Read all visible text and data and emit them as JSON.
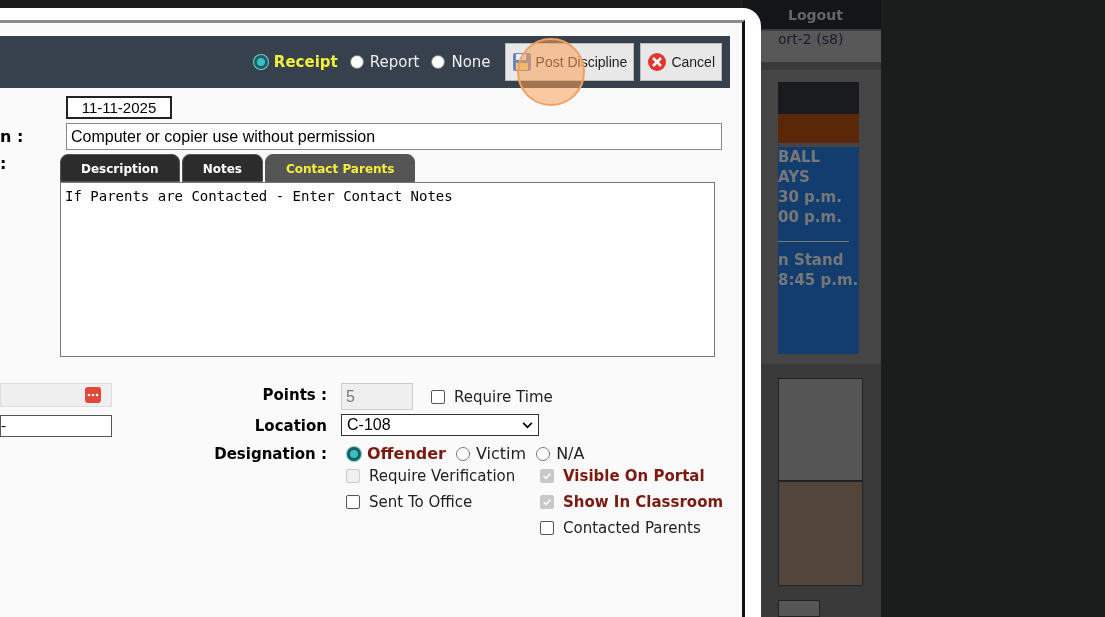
{
  "dialog": {
    "print_options": [
      {
        "label": "Receipt",
        "selected": true
      },
      {
        "label": "Report",
        "selected": false
      },
      {
        "label": "None",
        "selected": false
      }
    ],
    "buttons": [
      {
        "kind": "save",
        "label": "Post Discipline"
      },
      {
        "kind": "cancel",
        "label": "Cancel"
      }
    ],
    "date": "11-11-2025",
    "offense_label": "n :",
    "offense": "Computer or copier use without permission",
    "notes_label": ":",
    "tabs": [
      {
        "label": "Description",
        "selected": false
      },
      {
        "label": "Notes",
        "selected": false
      },
      {
        "label": "Contact Parents",
        "selected": true
      }
    ],
    "notes_text": "If Parents are Contacted - Enter Contact Notes",
    "left_field_value": "-",
    "points_label": "Points :",
    "points": "5",
    "require_time": {
      "label": "Require Time",
      "checked": false,
      "disabled": false
    },
    "location_label": "Location",
    "location": "C-108",
    "designation_label": "Designation :",
    "designations": [
      {
        "label": "Offender",
        "selected": true
      },
      {
        "label": "Victim",
        "selected": false
      },
      {
        "label": "N/A",
        "selected": false
      }
    ],
    "options": [
      {
        "label": "Require Verification",
        "checked": false,
        "disabled": true
      },
      {
        "label": "Visible On Portal",
        "checked": true,
        "disabled": true
      },
      {
        "label": "Sent To Office",
        "checked": false,
        "disabled": false
      },
      {
        "label": "Show In Classroom",
        "checked": true,
        "disabled": true
      },
      {
        "label": "Contacted Parents",
        "checked": false,
        "disabled": false
      }
    ]
  },
  "background_page": {
    "nav": "Logout",
    "subtitle": "ort-2 (s8)",
    "banner_lines": [
      "BALL",
      "AYS",
      "30 p.m.",
      "00 p.m."
    ],
    "banner_lines_2": [
      "n Stand",
      "8:45 p.m."
    ]
  }
}
